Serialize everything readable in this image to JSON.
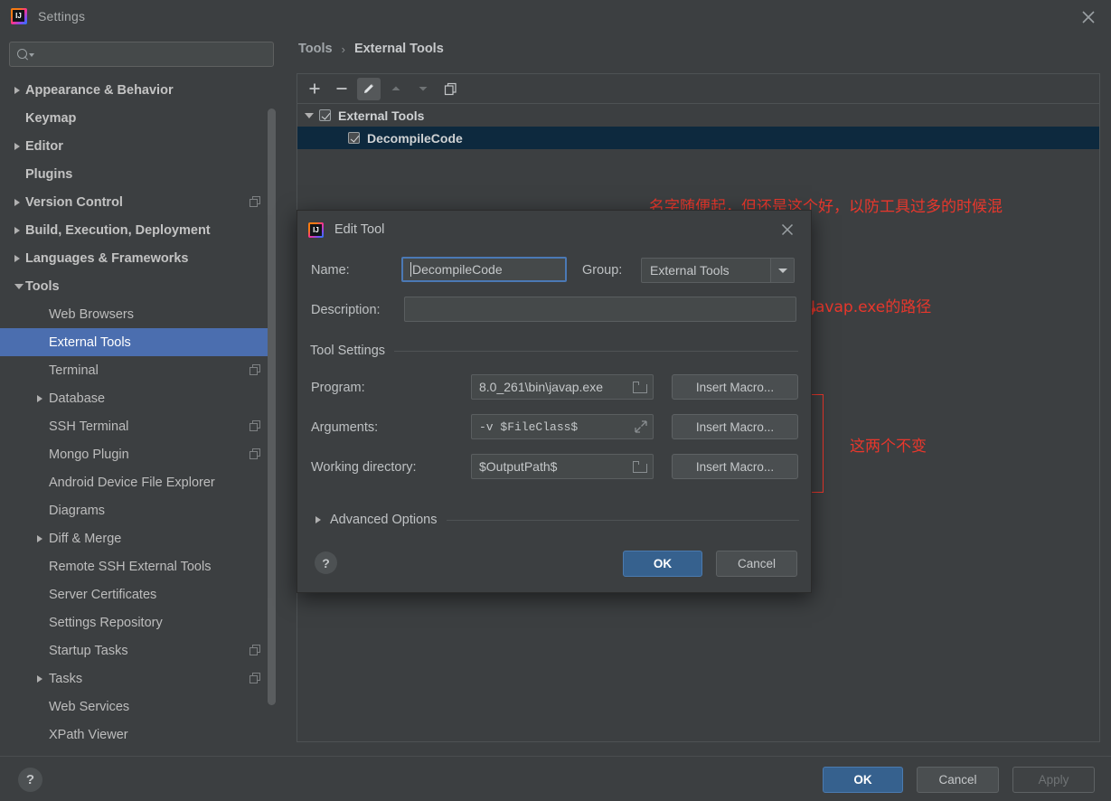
{
  "window": {
    "title": "Settings",
    "close_icon": "close-icon"
  },
  "search": {
    "value": "",
    "placeholder": "",
    "icon": "search-icon"
  },
  "sidebar": {
    "items": [
      {
        "label": "Appearance & Behavior",
        "level": 0,
        "arrow": "collapsed",
        "copy": false,
        "selected": false
      },
      {
        "label": "Keymap",
        "level": 0,
        "arrow": "none",
        "copy": false,
        "selected": false
      },
      {
        "label": "Editor",
        "level": 0,
        "arrow": "collapsed",
        "copy": false,
        "selected": false
      },
      {
        "label": "Plugins",
        "level": 0,
        "arrow": "none",
        "copy": false,
        "selected": false
      },
      {
        "label": "Version Control",
        "level": 0,
        "arrow": "collapsed",
        "copy": true,
        "selected": false
      },
      {
        "label": "Build, Execution, Deployment",
        "level": 0,
        "arrow": "collapsed",
        "copy": false,
        "selected": false
      },
      {
        "label": "Languages & Frameworks",
        "level": 0,
        "arrow": "collapsed",
        "copy": false,
        "selected": false
      },
      {
        "label": "Tools",
        "level": 0,
        "arrow": "expanded",
        "copy": false,
        "selected": false
      },
      {
        "label": "Web Browsers",
        "level": 1,
        "arrow": "none",
        "copy": false,
        "selected": false
      },
      {
        "label": "External Tools",
        "level": 1,
        "arrow": "none",
        "copy": false,
        "selected": true
      },
      {
        "label": "Terminal",
        "level": 1,
        "arrow": "none",
        "copy": true,
        "selected": false
      },
      {
        "label": "Database",
        "level": 1,
        "arrow": "collapsed",
        "copy": false,
        "selected": false
      },
      {
        "label": "SSH Terminal",
        "level": 1,
        "arrow": "none",
        "copy": true,
        "selected": false
      },
      {
        "label": "Mongo Plugin",
        "level": 1,
        "arrow": "none",
        "copy": true,
        "selected": false
      },
      {
        "label": "Android Device File Explorer",
        "level": 1,
        "arrow": "none",
        "copy": false,
        "selected": false
      },
      {
        "label": "Diagrams",
        "level": 1,
        "arrow": "none",
        "copy": false,
        "selected": false
      },
      {
        "label": "Diff & Merge",
        "level": 1,
        "arrow": "collapsed",
        "copy": false,
        "selected": false
      },
      {
        "label": "Remote SSH External Tools",
        "level": 1,
        "arrow": "none",
        "copy": false,
        "selected": false
      },
      {
        "label": "Server Certificates",
        "level": 1,
        "arrow": "none",
        "copy": false,
        "selected": false
      },
      {
        "label": "Settings Repository",
        "level": 1,
        "arrow": "none",
        "copy": false,
        "selected": false
      },
      {
        "label": "Startup Tasks",
        "level": 1,
        "arrow": "none",
        "copy": true,
        "selected": false
      },
      {
        "label": "Tasks",
        "level": 1,
        "arrow": "collapsed",
        "copy": true,
        "selected": false
      },
      {
        "label": "Web Services",
        "level": 1,
        "arrow": "none",
        "copy": false,
        "selected": false
      },
      {
        "label": "XPath Viewer",
        "level": 1,
        "arrow": "none",
        "copy": false,
        "selected": false
      }
    ]
  },
  "breadcrumb": {
    "parent": "Tools",
    "separator": "›",
    "current": "External Tools"
  },
  "toolbar": {
    "add": "+",
    "remove": "−",
    "edit_icon": "pencil-icon",
    "up_icon": "arrow-up-icon",
    "down_icon": "arrow-down-icon",
    "copy_icon": "copy-icon"
  },
  "tools_tree": {
    "group": "External Tools",
    "group_checked": true,
    "children": [
      {
        "label": "DecompileCode",
        "checked": true,
        "selected": true
      }
    ]
  },
  "dialog": {
    "title": "Edit Tool",
    "close_icon": "close-icon",
    "name_label": "Name:",
    "name_value": "DecompileCode",
    "group_label": "Group:",
    "group_value": "External Tools",
    "description_label": "Description:",
    "description_value": "",
    "tool_settings_label": "Tool Settings",
    "program_label": "Program:",
    "program_value": "8.0_261\\bin\\javap.exe",
    "arguments_label": "Arguments:",
    "arguments_value": "-v $FileClass$",
    "working_dir_label": "Working directory:",
    "working_dir_value": "$OutputPath$",
    "insert_macro_label": "Insert Macro...",
    "advanced_options_label": "Advanced Options",
    "help_label": "?",
    "ok_label": "OK",
    "cancel_label": "Cancel"
  },
  "bottom": {
    "help_label": "?",
    "ok_label": "OK",
    "cancel_label": "Cancel",
    "apply_label": "Apply"
  },
  "annotations": [
    {
      "text": "名字随便起，但还是这个好，以防工具过多的时候混"
    },
    {
      "text": "Javap.exe的路径"
    },
    {
      "text": "这两个不变"
    }
  ],
  "colors": {
    "accent_blue": "#4b6eaf",
    "annotation_red": "#e8372c",
    "window_bg": "#3c3f41",
    "selection_row": "#0d293e"
  }
}
